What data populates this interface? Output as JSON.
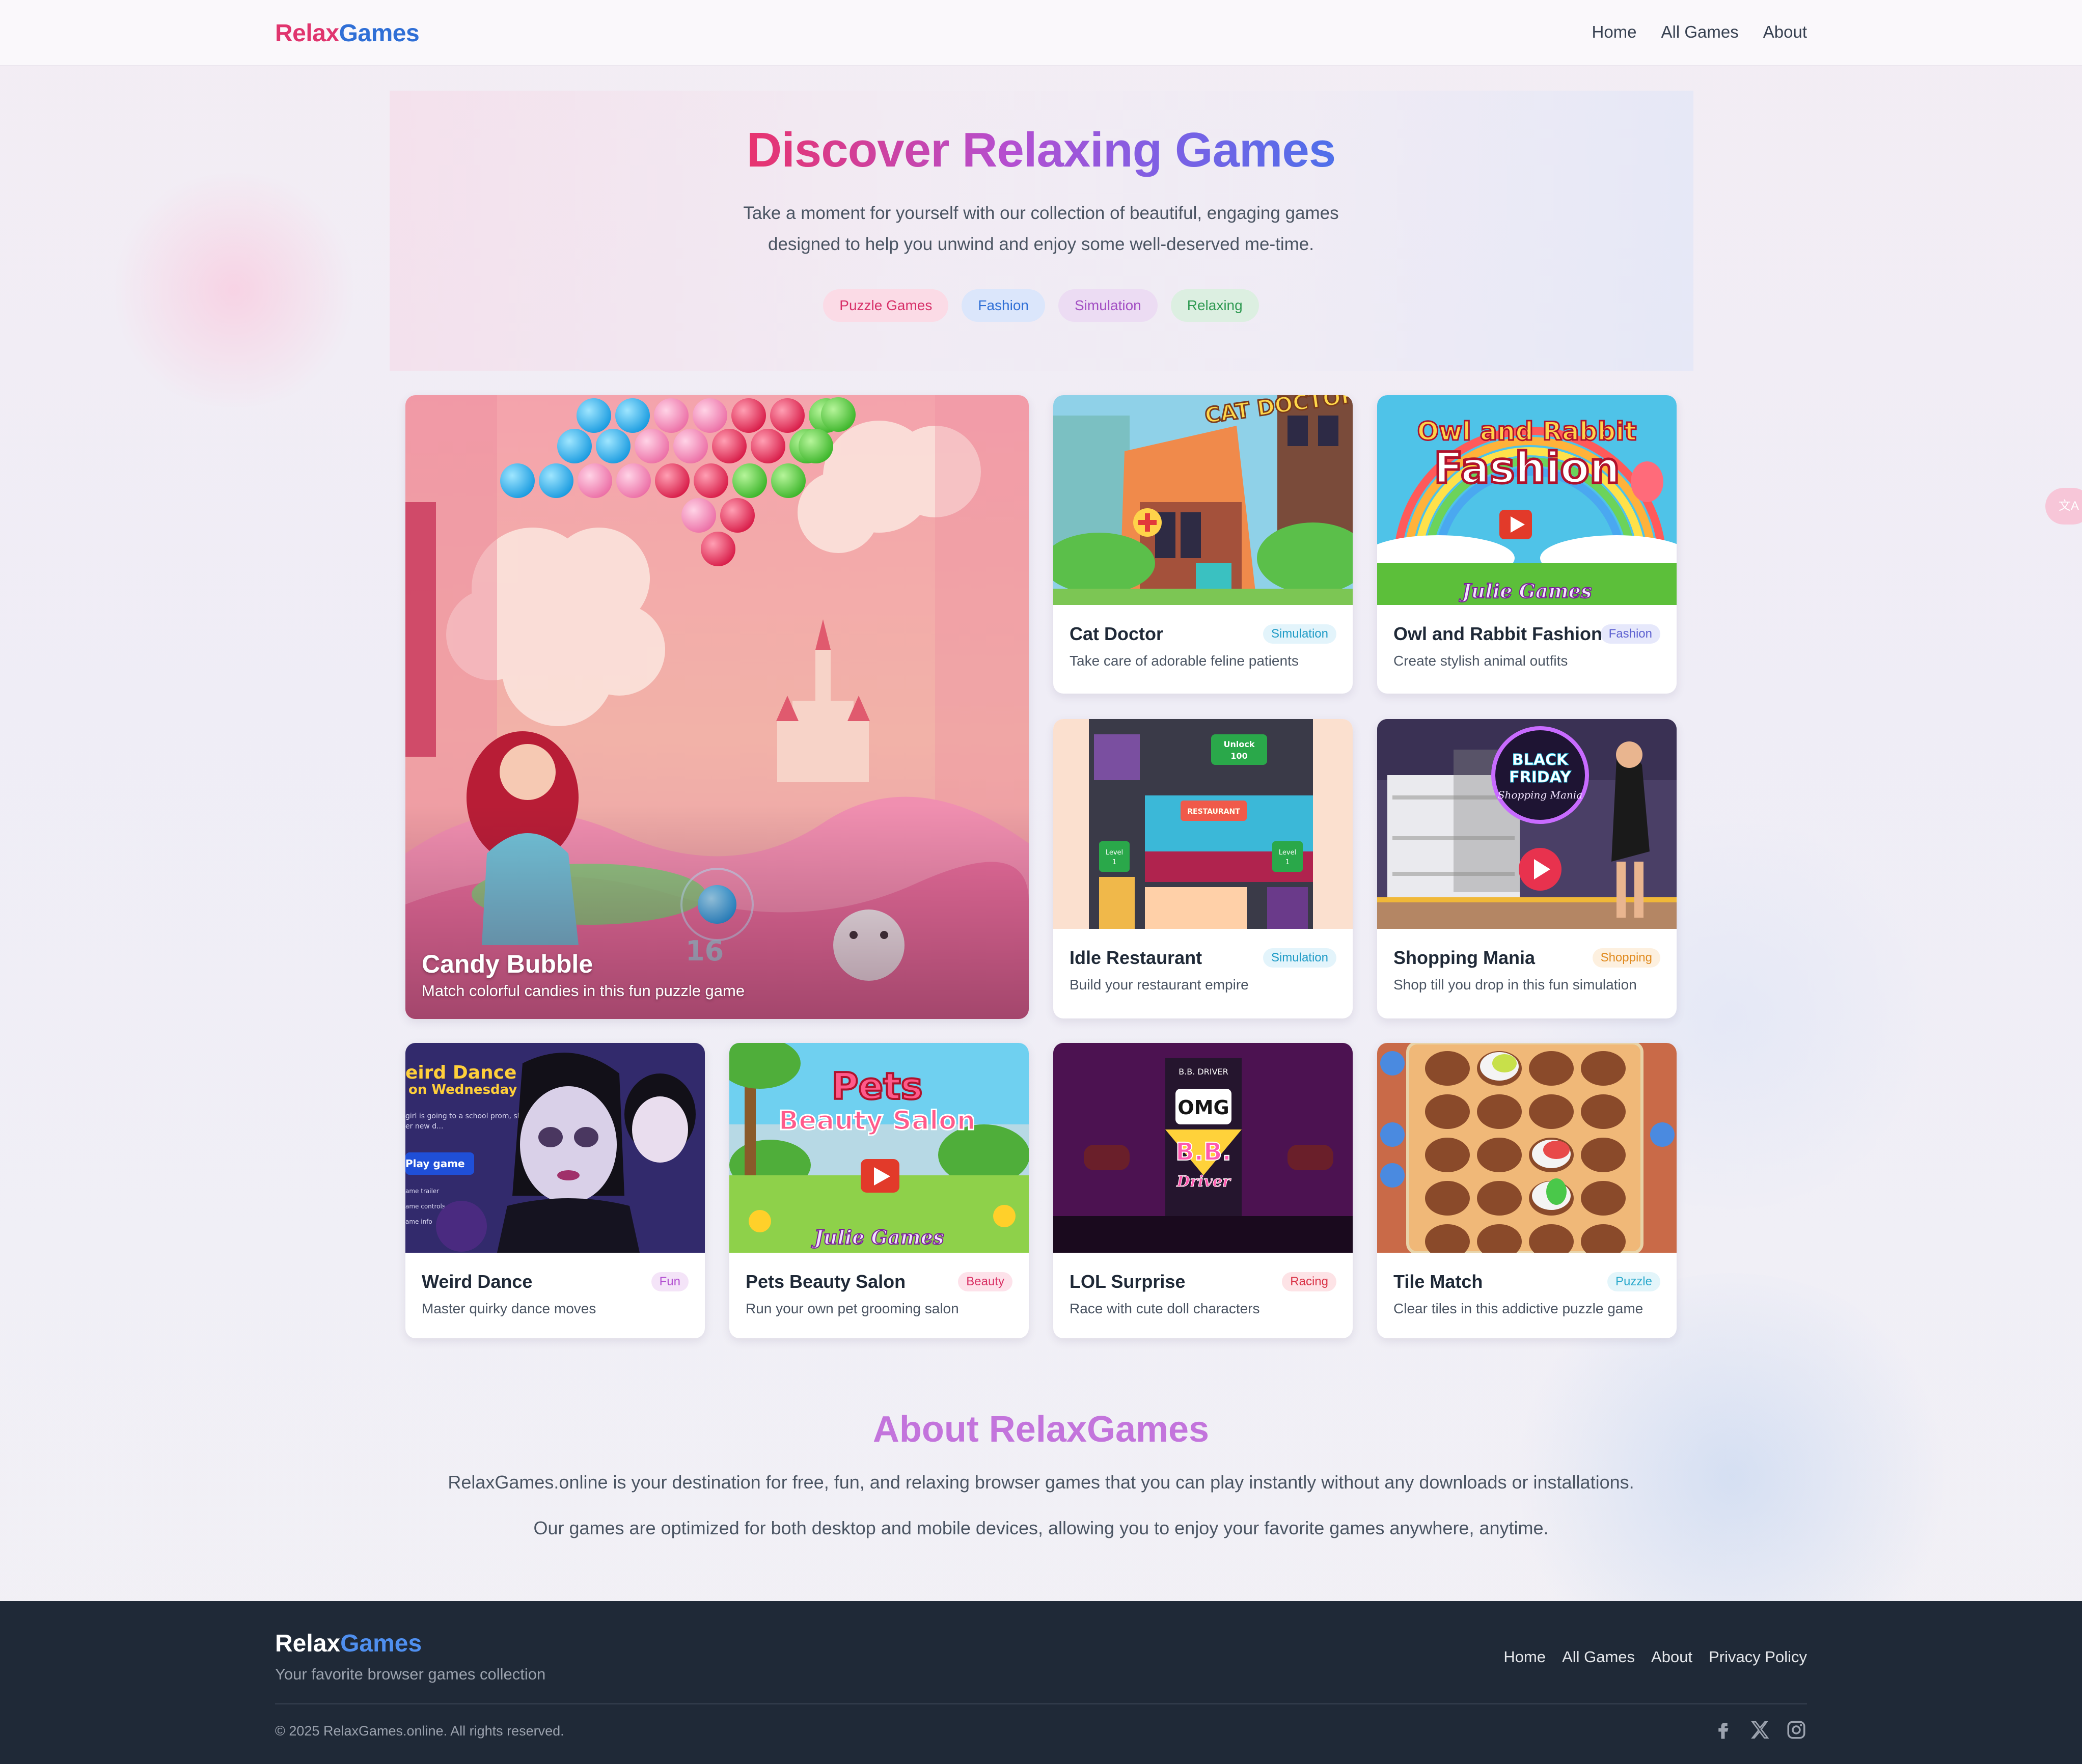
{
  "brand": {
    "logo_part1": "Relax",
    "logo_part2": "Games"
  },
  "nav": {
    "items": [
      "Home",
      "All Games",
      "About"
    ]
  },
  "hero": {
    "title": "Discover Relaxing Games",
    "subtitle_line1": "Take a moment for yourself with our collection of beautiful, engaging games",
    "subtitle_line2": "designed to help you unwind and enjoy some well-deserved me-time.",
    "chips": [
      "Puzzle Games",
      "Fashion",
      "Simulation",
      "Relaxing"
    ]
  },
  "featured": {
    "title": "Candy Bubble",
    "description": "Match colorful candies in this fun puzzle game",
    "thumb_text": "16"
  },
  "games": [
    {
      "title": "Cat Doctor",
      "tag": "Simulation",
      "description": "Take care of adorable feline patients",
      "thumb_text": "CAT DOCTOR"
    },
    {
      "title": "Owl and Rabbit Fashion",
      "tag": "Fashion",
      "description": "Create stylish animal outfits",
      "thumb_line1": "Owl and Rabbit",
      "thumb_line2": "Fashion",
      "thumb_sig": "Julie Games"
    },
    {
      "title": "Idle Restaurant",
      "tag": "Simulation",
      "description": "Build your restaurant empire",
      "thumb_unlock": "Unlock",
      "thumb_cost": "100",
      "thumb_level": "Level",
      "thumb_level_num": "1",
      "thumb_sign": "RESTAURANT"
    },
    {
      "title": "Shopping Mania",
      "tag": "Shopping",
      "description": "Shop till you drop in this fun simulation",
      "thumb_line1": "BLACK",
      "thumb_line2": "FRIDAY",
      "thumb_line3": "Shopping Mania"
    },
    {
      "title": "Weird Dance",
      "tag": "Fun",
      "description": "Master quirky dance moves",
      "thumb_title1": "eird Dance",
      "thumb_title2": "on Wednesday",
      "thumb_blurb1": "girl is going to a school prom, she wants to make a splash",
      "thumb_blurb2": "er new d...",
      "thumb_play": "Play game",
      "thumb_menu": [
        "ame trailer",
        "ame controls",
        "ame info"
      ]
    },
    {
      "title": "Pets Beauty Salon",
      "tag": "Beauty",
      "description": "Run your own pet grooming salon",
      "thumb_line1": "Pets",
      "thumb_line2": "Beauty Salon",
      "thumb_sig": "Julie Games"
    },
    {
      "title": "LOL Surprise",
      "tag": "Racing",
      "description": "Race with cute doll characters",
      "thumb_line1": "B.B. DRIVER",
      "thumb_line2": "OMG",
      "thumb_line3": "B.B.",
      "thumb_line4": "Driver"
    },
    {
      "title": "Tile Match",
      "tag": "Puzzle",
      "description": "Clear tiles in this addictive puzzle game"
    }
  ],
  "about": {
    "title": "About RelaxGames",
    "p1": "RelaxGames.online is your destination for free, fun, and relaxing browser games that you can play instantly without any downloads or installations.",
    "p2": "Our games are optimized for both desktop and mobile devices, allowing you to enjoy your favorite games anywhere, anytime."
  },
  "footer": {
    "tagline": "Your favorite browser games collection",
    "links": [
      "Home",
      "All Games",
      "About",
      "Privacy Policy"
    ],
    "copyright": "© 2025 RelaxGames.online. All rights reserved.",
    "social_icons": [
      "facebook-icon",
      "x-icon",
      "instagram-icon"
    ]
  },
  "translate_button": {
    "icon": "translate-icon",
    "label": "文A"
  },
  "colors": {
    "brand_pink": "#e0356e",
    "brand_blue": "#2f6fd6",
    "footer_bg": "#1f2937",
    "about_purple": "#c374dc"
  }
}
